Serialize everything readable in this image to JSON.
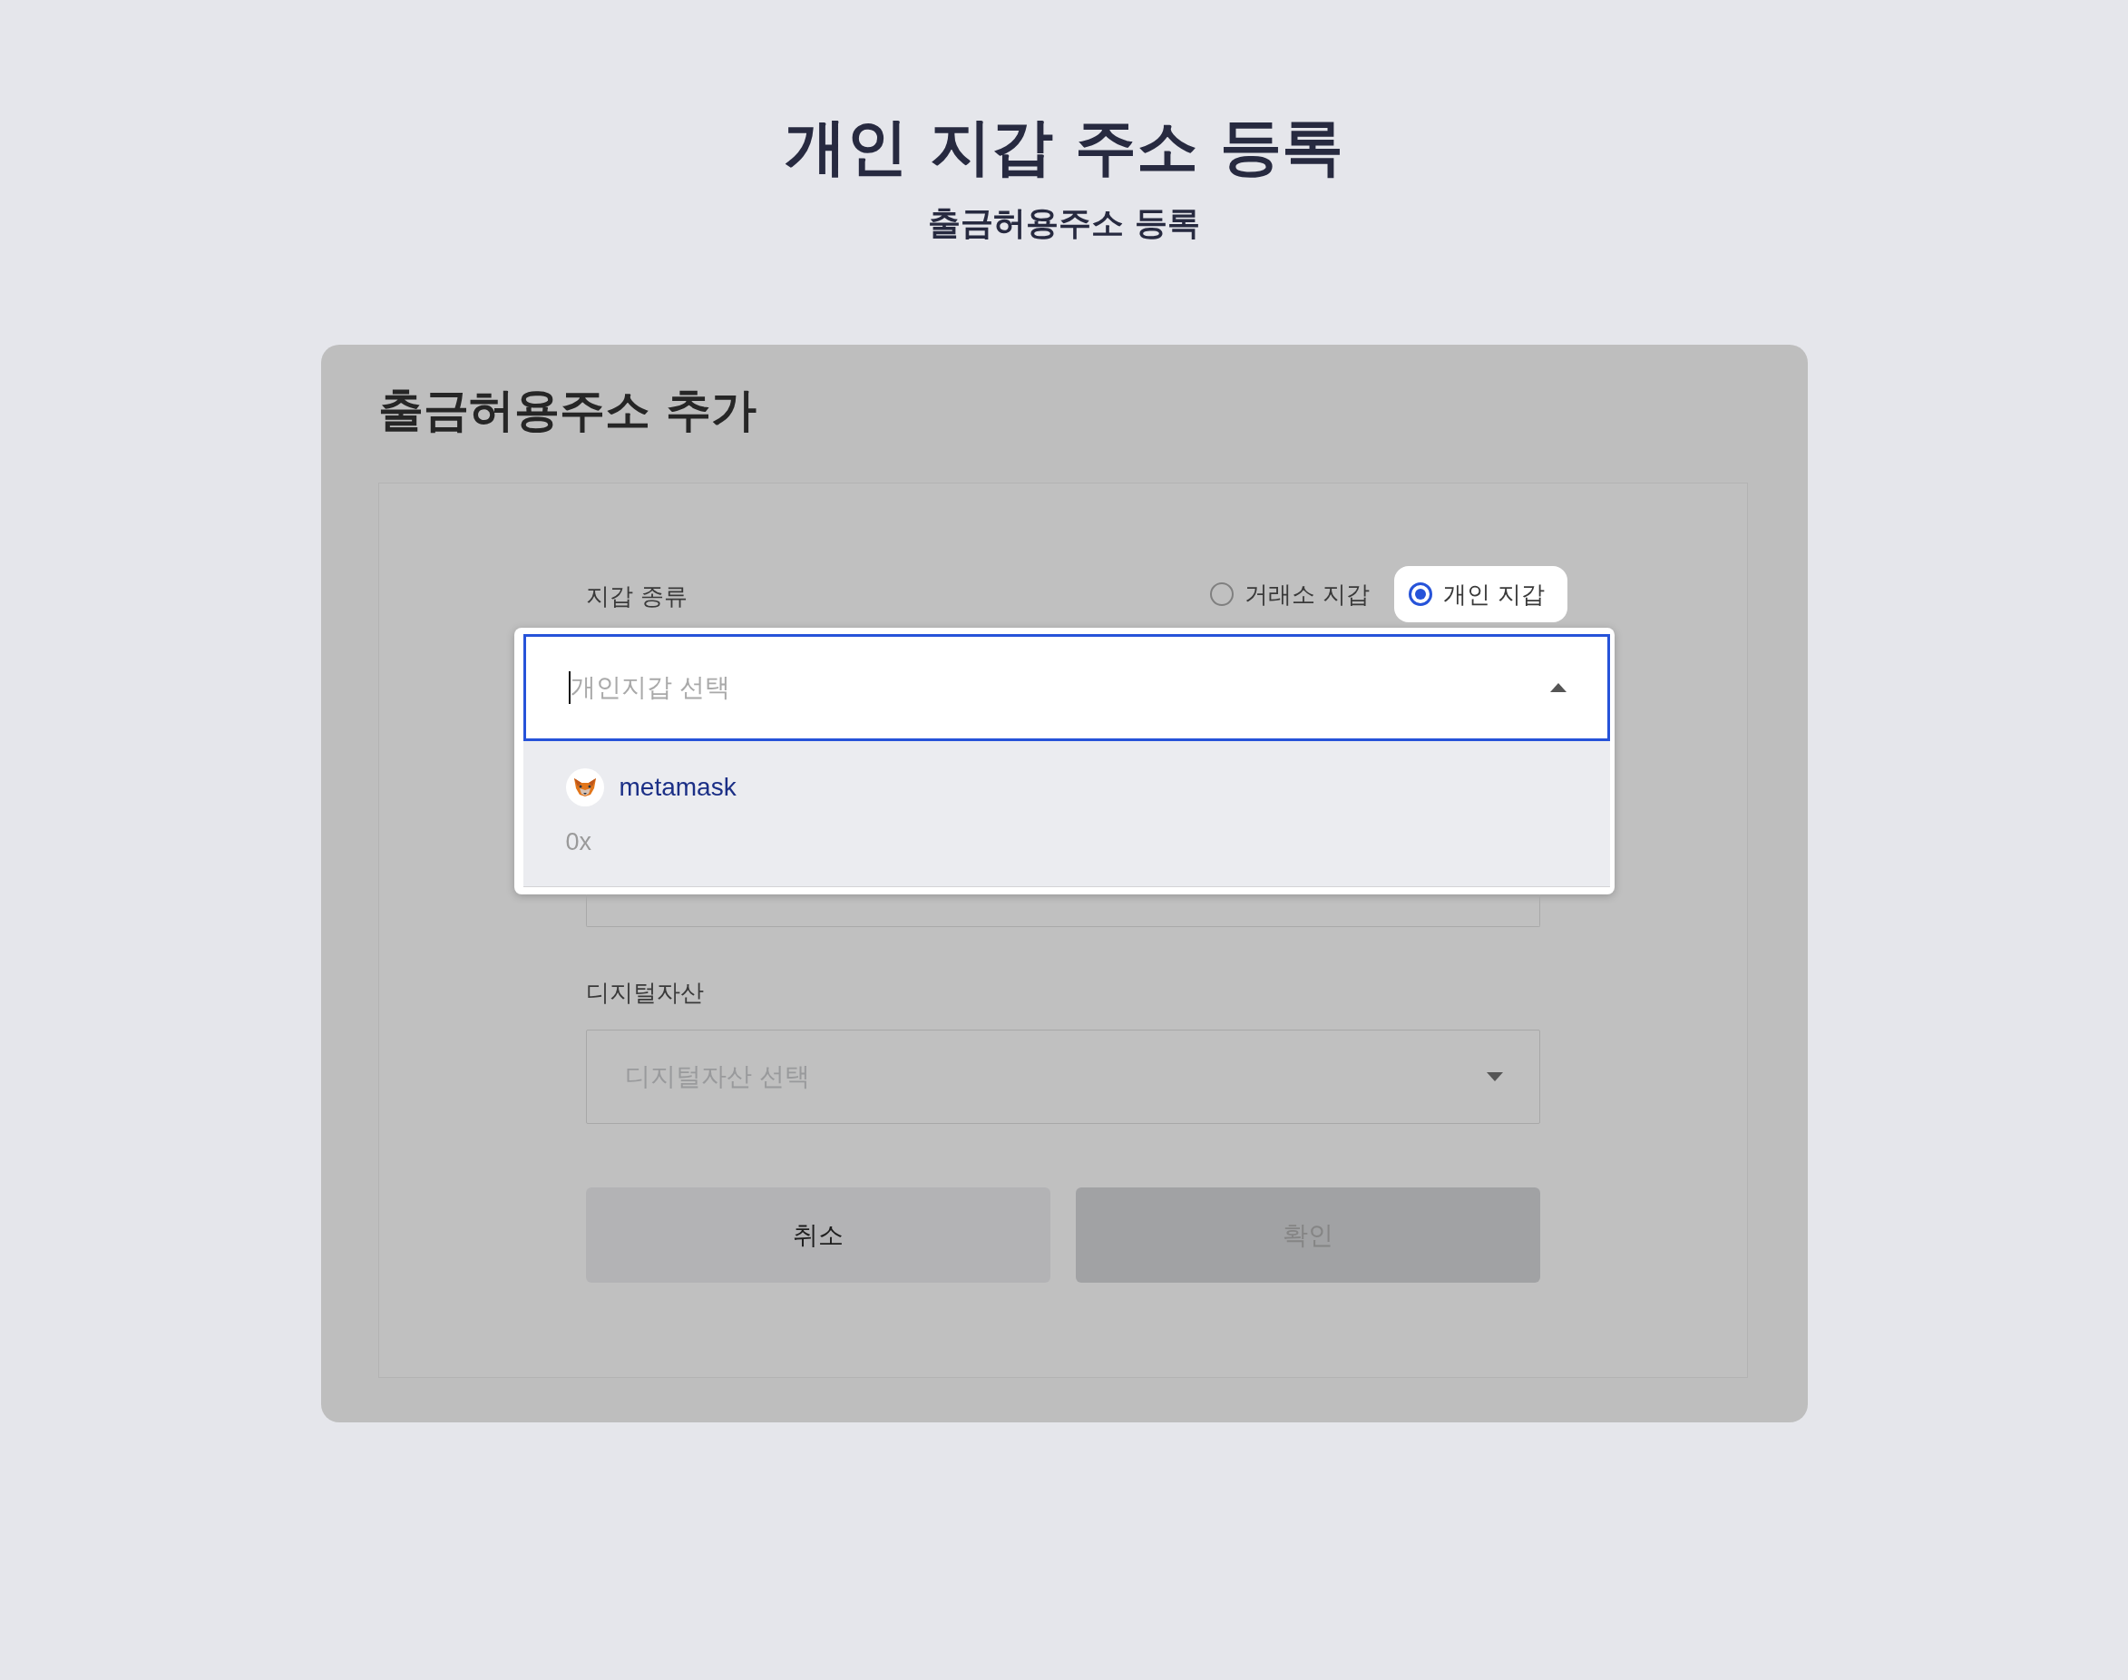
{
  "page": {
    "title": "개인 지갑 주소 등록",
    "subtitle": "출금허용주소 등록"
  },
  "card": {
    "title": "출금허용주소 추가",
    "wallet_type": {
      "label": "지갑 종류",
      "options": [
        {
          "label": "거래소 지갑",
          "selected": false
        },
        {
          "label": "개인 지갑",
          "selected": true
        }
      ]
    },
    "wallet_select": {
      "placeholder": "개인지갑 선택",
      "expanded": true,
      "options": [
        {
          "name": "metamask",
          "address": "0x"
        }
      ]
    },
    "asset": {
      "label": "디지털자산",
      "select": {
        "placeholder": "디지털자산 선택",
        "expanded": false
      }
    },
    "buttons": [
      {
        "kind": "cancel",
        "label": "취소",
        "disabled": false
      },
      {
        "kind": "confirm",
        "label": "확인",
        "disabled": true
      }
    ]
  }
}
